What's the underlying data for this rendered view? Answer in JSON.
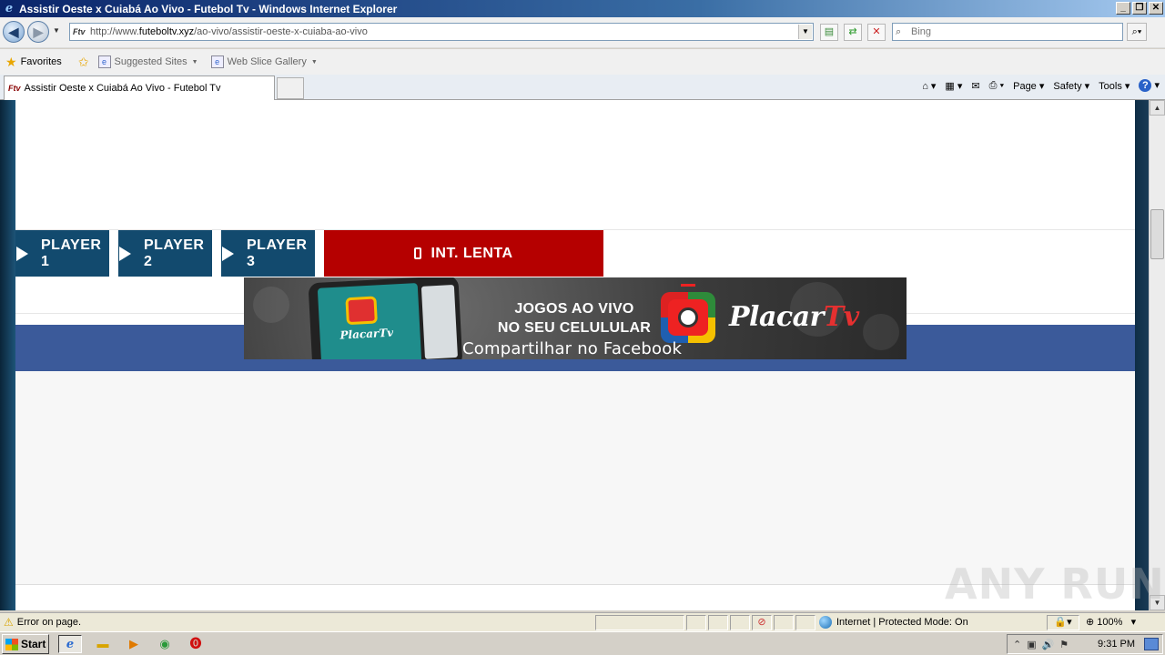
{
  "window": {
    "title": "Assistir Oeste x Cuiabá Ao Vivo - Futebol Tv - Windows Internet Explorer",
    "minimize": "_",
    "restore": "❐",
    "close": "✕"
  },
  "address_bar": {
    "url_prefix": "http://www.",
    "url_host": "futeboltv.xyz",
    "url_path": "/ao-vivo/assistir-oeste-x-cuiaba-ao-vivo",
    "site_icon": "Ftv",
    "search_placeholder": "Bing"
  },
  "favorites_bar": {
    "favorites_label": "Favorites",
    "suggested_sites": "Suggested Sites",
    "web_slice_gallery": "Web Slice Gallery"
  },
  "tabs": [
    {
      "label": "Assistir Oeste x Cuiabá Ao Vivo - Futebol Tv",
      "icon": "Ftv"
    }
  ],
  "command_bar": {
    "page": "Page",
    "safety": "Safety",
    "tools": "Tools",
    "help": "?"
  },
  "page": {
    "players": [
      {
        "label": "PLAYER 1"
      },
      {
        "label": "PLAYER 2"
      },
      {
        "label": "PLAYER 3"
      }
    ],
    "lenta_button": "INT. LENTA",
    "banner": {
      "headline_line1": "JOGOS AO VIVO",
      "headline_line2": "NO SEU CELULULAR",
      "brand_main": "Placar",
      "brand_tv": "Tv",
      "phone_brand": "PlacarTv"
    },
    "facebook_share": "Compartilhar no Facebook"
  },
  "status_bar": {
    "message": "Error on page.",
    "zone": "Internet | Protected Mode: On",
    "zoom": "100%"
  },
  "taskbar": {
    "start": "Start",
    "clock": "9:31 PM"
  },
  "watermark": "ANY RUN",
  "colors": {
    "player_button": "#124a6e",
    "lenta_button": "#b50000",
    "facebook_bar": "#3b5a9a"
  }
}
